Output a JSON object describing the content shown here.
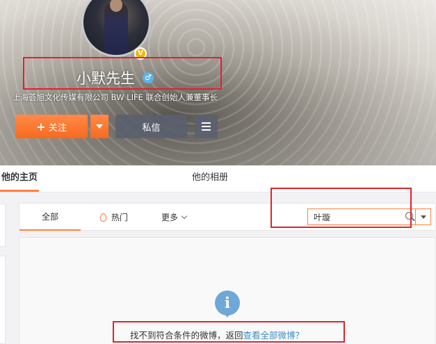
{
  "profile": {
    "nickname": "小默先生",
    "verified_badge": "V",
    "gender_symbol": "♂",
    "bio": "上海荟旭文化传媒有限公司 BW LIFE 联合创始人兼董事长"
  },
  "actions": {
    "follow_plus": "+",
    "follow_label": "关注",
    "message_label": "私信"
  },
  "tabs": {
    "home": "他的主页",
    "album": "他的相册"
  },
  "filters": {
    "all": "全部",
    "hot": "热门",
    "more": "更多"
  },
  "search": {
    "value": "叶璇"
  },
  "empty_state": {
    "icon_glyph": "i",
    "message": "找不到符合条件的微博，返回",
    "link": "查看全部微博？"
  },
  "colors": {
    "accent": "#ff8140",
    "highlight_box": "#e0222a",
    "link": "#3f8dc7"
  },
  "icons": [
    "verified-v-icon",
    "male-gender-icon",
    "plus-icon",
    "chevron-down-icon",
    "menu-icon",
    "fire-icon",
    "search-icon",
    "info-icon"
  ]
}
